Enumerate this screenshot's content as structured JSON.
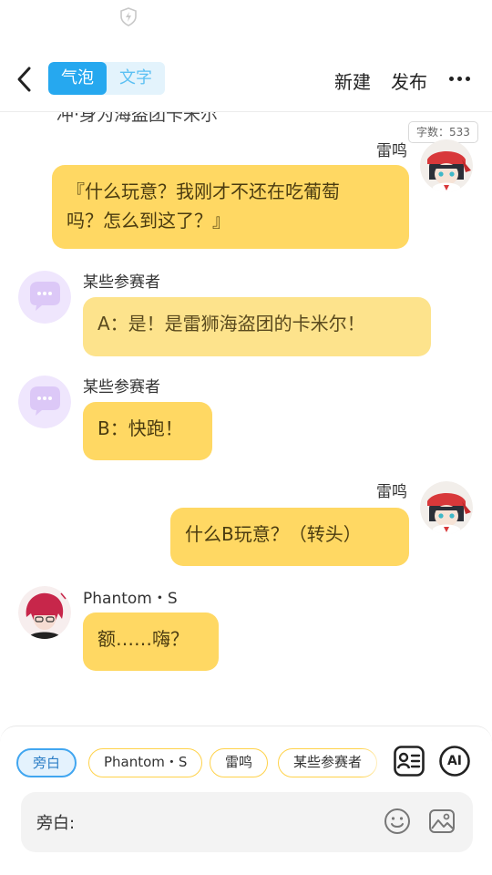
{
  "icons": {
    "status": "shield-lightning-icon",
    "back": "chevron-left-icon",
    "more": "ellipsis-icon",
    "character_card": "character-card-icon",
    "ai": "ai-icon",
    "emoji": "smiley-icon",
    "image": "image-icon"
  },
  "colors": {
    "accent_blue": "#26a8ef",
    "bubble_yellow": "#ffd863",
    "bubble_pale_yellow": "#fde38c",
    "chip_border": "#ffd24a",
    "placeholder_avatar": "#dcc8f7"
  },
  "header": {
    "mode_tabs": [
      "气泡",
      "文字"
    ],
    "active_mode": "气泡",
    "new_label": "新建",
    "publish_label": "发布"
  },
  "chat": {
    "cut_text": "冲·身为海盗团卡米尔",
    "word_count": "字数：533",
    "messages": [
      {
        "speaker": "雷鸣",
        "side": "right",
        "text_lines": [
          "『什么玩意？我刚才不还在吃葡萄",
          "吗？怎么到这了？』"
        ]
      },
      {
        "speaker": "某些参赛者",
        "side": "left",
        "text_lines": [
          "A：是！是雷狮海盗团的卡米尔！"
        ]
      },
      {
        "speaker": "某些参赛者",
        "side": "left",
        "text_lines": [
          "B：快跑！"
        ]
      },
      {
        "speaker": "雷鸣",
        "side": "right",
        "text_lines": [
          "什么B玩意？（转头）"
        ]
      },
      {
        "speaker": "Phantom・S",
        "side": "left",
        "text_lines": [
          "额……嗨？"
        ]
      }
    ]
  },
  "composer": {
    "chips": [
      "旁白",
      "Phantom・S",
      "雷鸣",
      "某些参赛者"
    ],
    "active_chip": "旁白",
    "ai_label": "AI",
    "input_label": "旁白:",
    "input_value": ""
  }
}
